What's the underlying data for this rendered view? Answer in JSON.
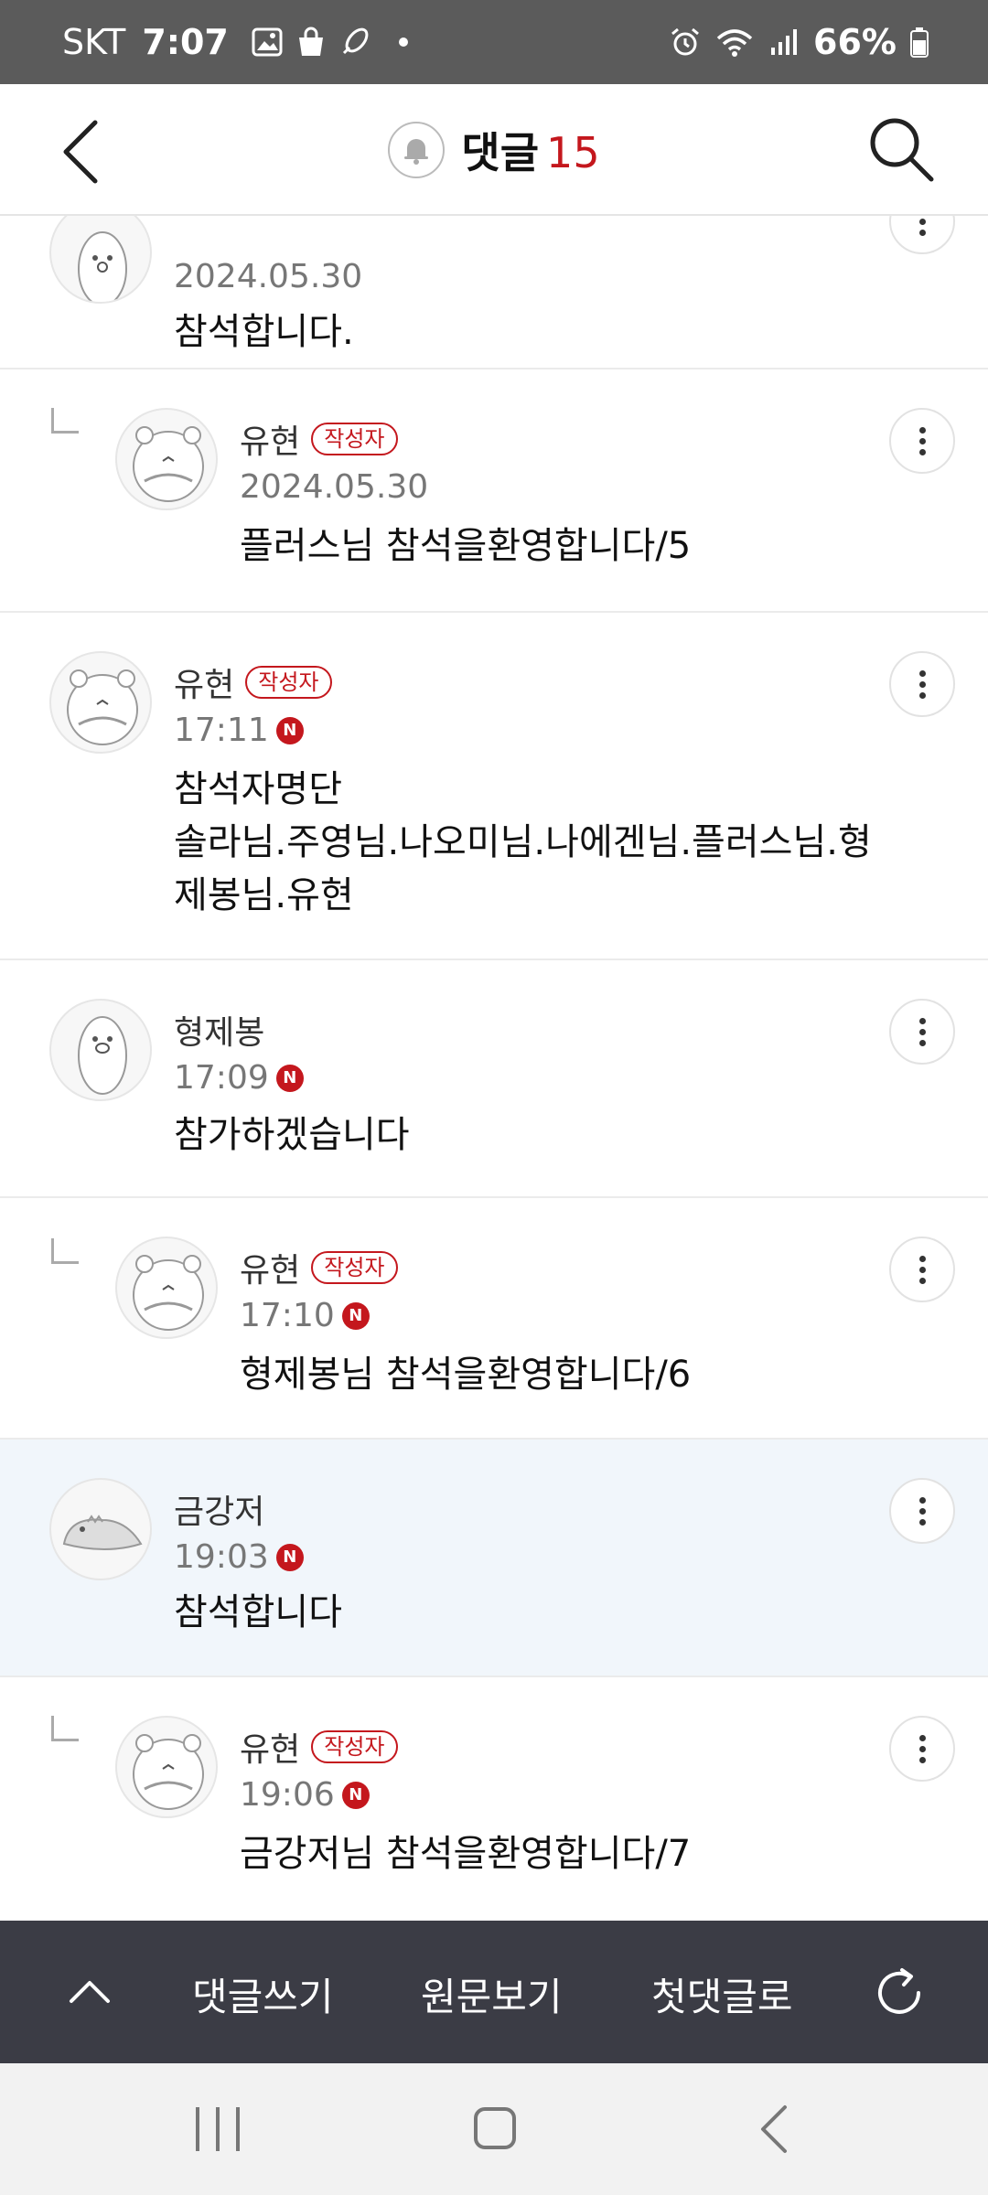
{
  "status_bar": {
    "carrier": "SKT",
    "time": "7:07",
    "battery": "66%",
    "icons": [
      "gallery-icon",
      "shopping-bag-icon",
      "rocket-icon",
      "alarm-icon",
      "wifi-icon",
      "signal-icon",
      "battery-icon"
    ]
  },
  "header": {
    "title": "댓글",
    "count": "15",
    "icons": [
      "back-arrow-icon",
      "bell-icon",
      "search-icon"
    ]
  },
  "comments": [
    {
      "nickname": "",
      "author_badge": "",
      "date": "2024.05.30",
      "new": false,
      "text": "참석합니다.",
      "reply": false
    },
    {
      "nickname": "유현",
      "author_badge": "작성자",
      "date": "2024.05.30",
      "new": false,
      "text": "플러스님 참석을환영합니다/5",
      "reply": true
    },
    {
      "nickname": "유현",
      "author_badge": "작성자",
      "date": "17:11",
      "new": true,
      "text": "참석자명단\n솔라님.주영님.나오미님.나에겐님.플러스님.형\n제봉님.유현",
      "reply": false
    },
    {
      "nickname": "형제봉",
      "author_badge": "",
      "date": "17:09",
      "new": true,
      "text": "참가하겠습니다",
      "reply": false
    },
    {
      "nickname": "유현",
      "author_badge": "작성자",
      "date": "17:10",
      "new": true,
      "text": "형제봉님 참석을환영합니다/6",
      "reply": true
    },
    {
      "nickname": "금강저",
      "author_badge": "",
      "date": "19:03",
      "new": true,
      "text": "참석합니다",
      "reply": false,
      "highlighted": true
    },
    {
      "nickname": "유현",
      "author_badge": "작성자",
      "date": "19:06",
      "new": true,
      "text": "금강저님 참석을환영합니다/7",
      "reply": true
    }
  ],
  "new_badge_label": "N",
  "bottom_bar": {
    "write_comment": "댓글쓰기",
    "view_original": "원문보기",
    "first_comment": "첫댓글로",
    "icons": [
      "chevron-up-icon",
      "refresh-icon"
    ]
  },
  "colors": {
    "accent": "#c4171d",
    "status_bar_bg": "#5b5b5b",
    "bottom_bar_bg": "#3b3c45",
    "highlight_bg": "#f1f6fb"
  }
}
